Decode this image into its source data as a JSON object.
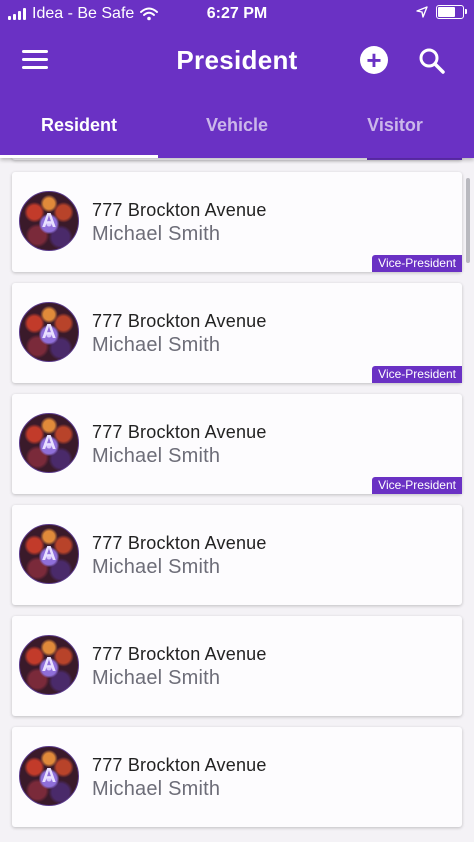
{
  "status_bar": {
    "carrier": "Idea - Be Safe",
    "time": "6:27 PM"
  },
  "app_bar": {
    "title": "President",
    "add_icon_glyph": "+"
  },
  "tabs": [
    {
      "label": "Resident",
      "active": true
    },
    {
      "label": "Vehicle",
      "active": false
    },
    {
      "label": "Visitor",
      "active": false
    }
  ],
  "cards": [
    {
      "address": "777 Brockton Avenue",
      "name": "Michael Smith",
      "role": "Vice-President"
    },
    {
      "address": "777 Brockton Avenue",
      "name": "Michael Smith",
      "role": "Vice-President"
    },
    {
      "address": "777 Brockton Avenue",
      "name": "Michael Smith",
      "role": "Vice-President"
    },
    {
      "address": "777 Brockton Avenue",
      "name": "Michael Smith",
      "role": ""
    },
    {
      "address": "777 Brockton Avenue",
      "name": "Michael Smith",
      "role": ""
    },
    {
      "address": "777 Brockton Avenue",
      "name": "Michael Smith",
      "role": ""
    }
  ],
  "colors": {
    "primary": "#6a31c4",
    "card_background": "#fdfcfe",
    "secondary_text": "#6d6d78"
  },
  "icons": {
    "menu": "menu-icon",
    "add": "add-circle-icon",
    "search": "search-icon",
    "wifi": "wifi-icon",
    "location": "location-arrow-icon",
    "battery": "battery-icon",
    "avatar_logo": "A"
  }
}
